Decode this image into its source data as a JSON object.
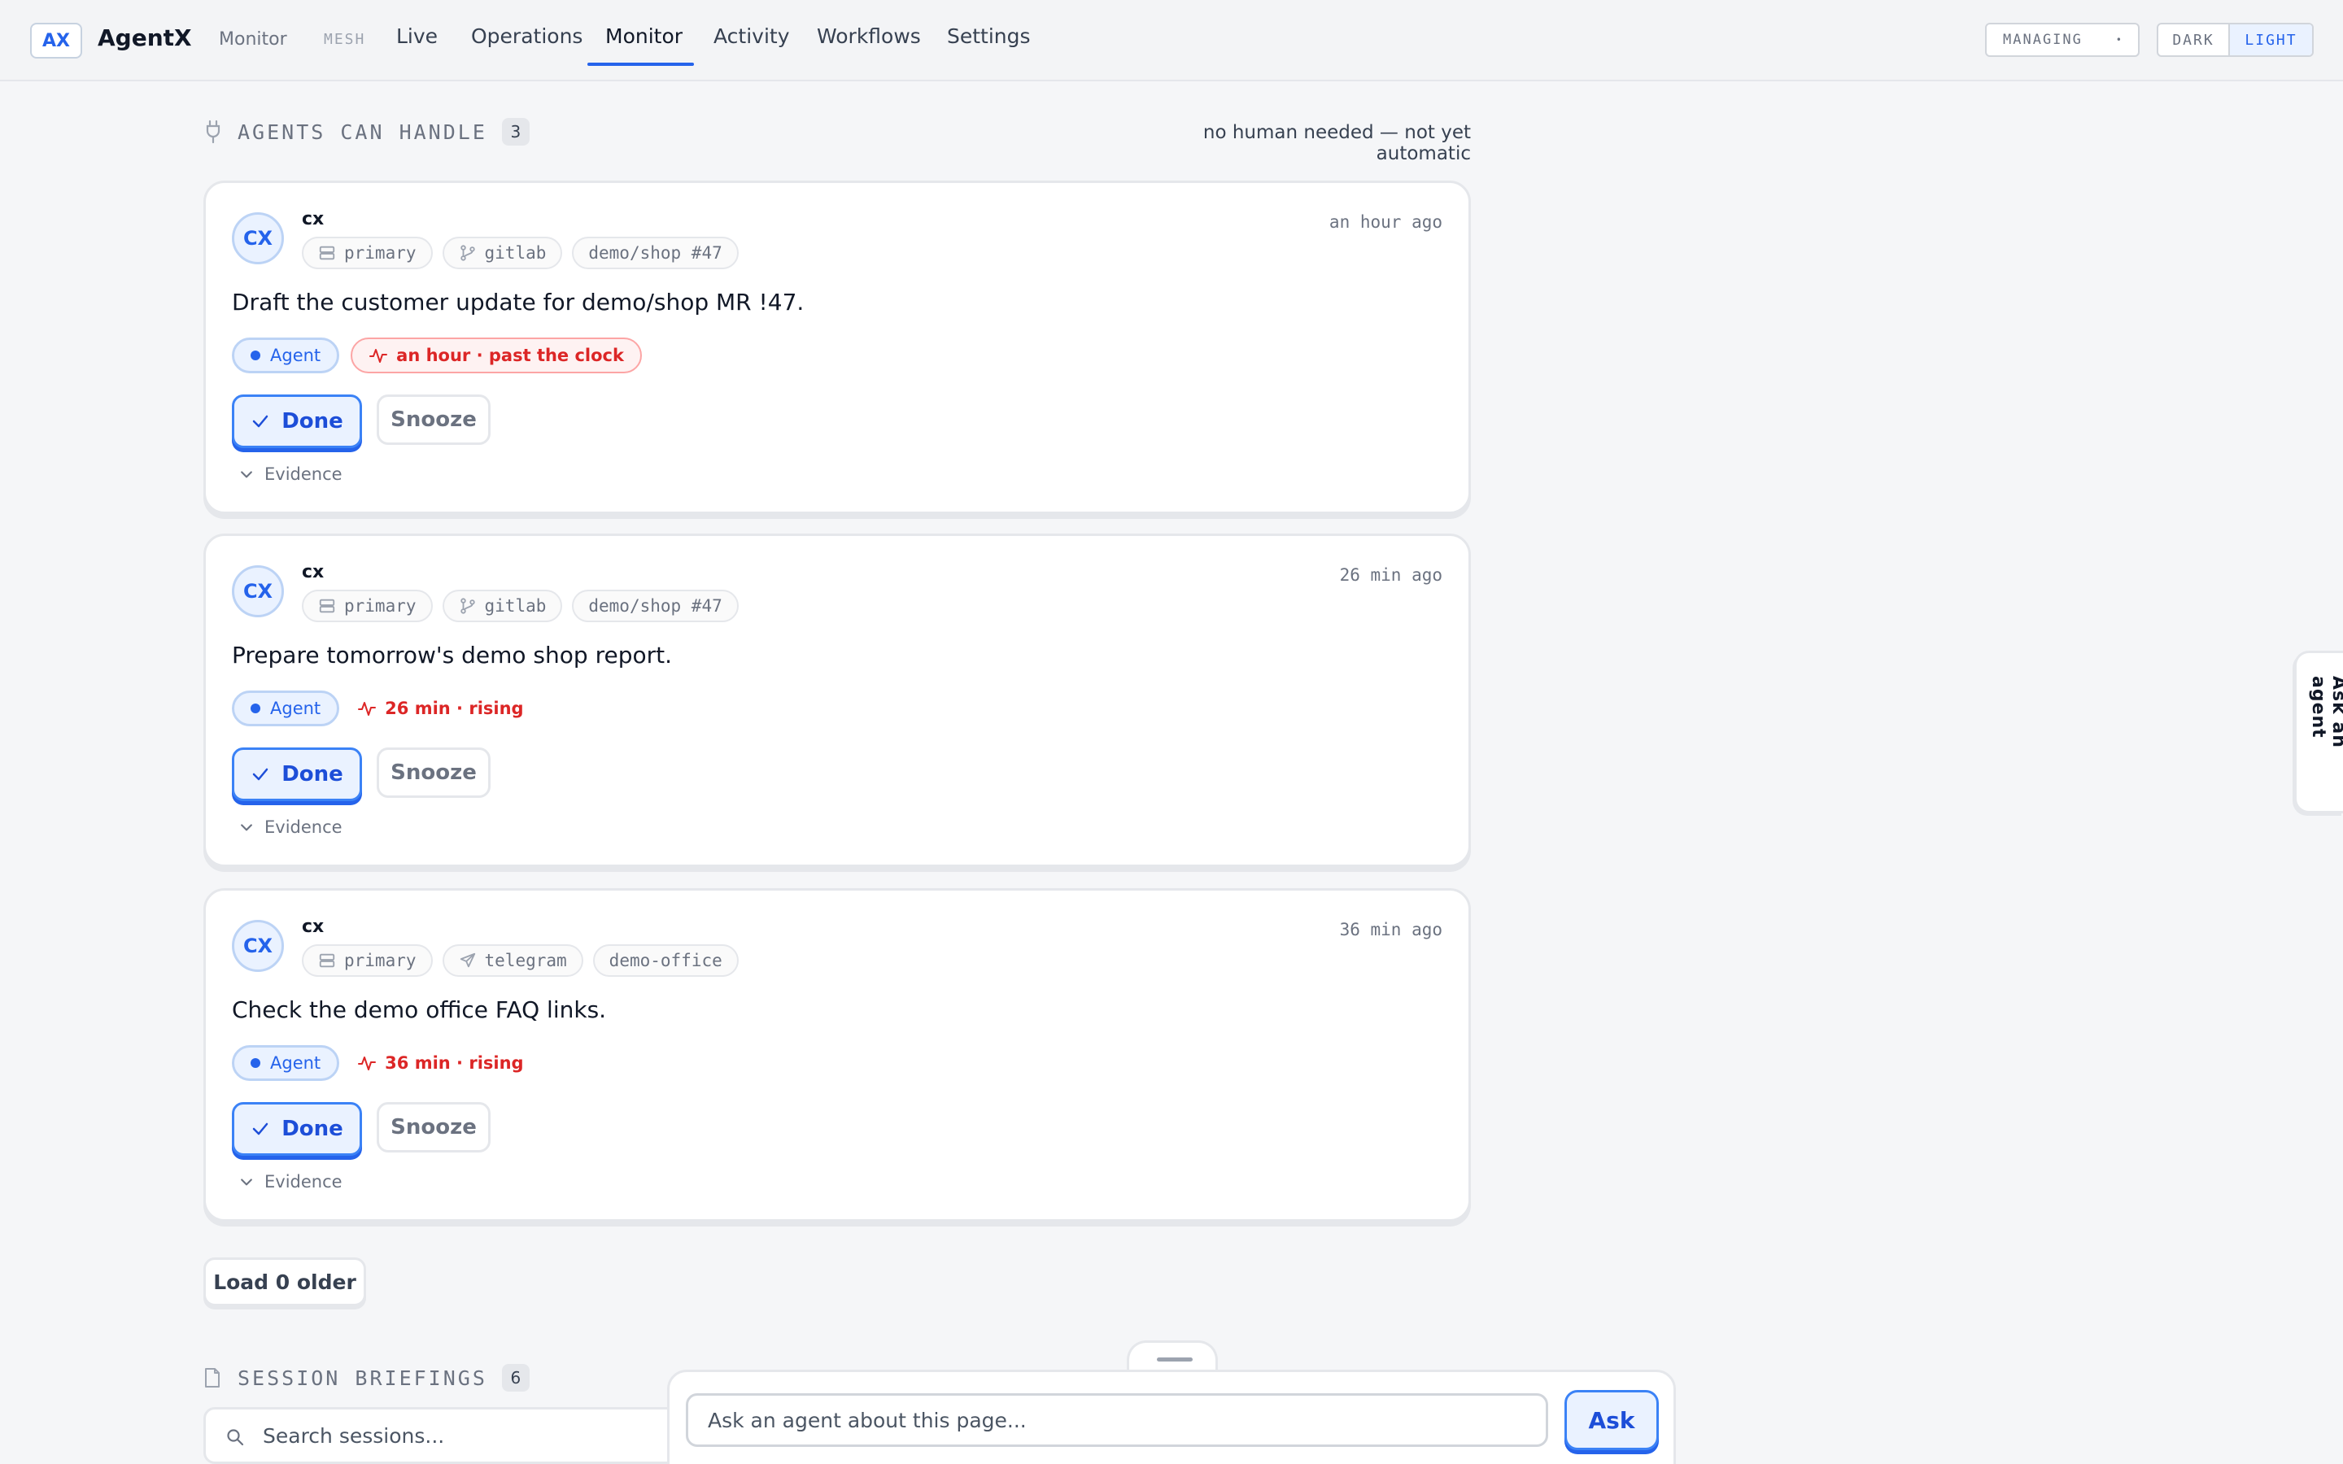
{
  "header": {
    "logo": "AX",
    "brand": "AgentX",
    "crumb": "Monitor",
    "mesh": "MESH",
    "tabs": [
      {
        "label": "Live"
      },
      {
        "label": "Operations"
      },
      {
        "label": "Monitor",
        "active": true
      },
      {
        "label": "Activity"
      },
      {
        "label": "Workflows"
      },
      {
        "label": "Settings"
      }
    ],
    "managing": "MANAGING",
    "theme_dark": "DARK",
    "theme_light": "LIGHT"
  },
  "section": {
    "title": "AGENTS CAN HANDLE",
    "count": "3",
    "note": "no human needed — not yet automatic"
  },
  "cards": [
    {
      "avatar": "CX",
      "author": "cx",
      "chips": [
        "primary",
        "gitlab",
        "demo/shop #47"
      ],
      "timestamp": "an hour ago",
      "task": "Draft the customer update for demo/shop MR !47.",
      "agent_tag": "Agent",
      "clock_tag": "an hour · past the clock",
      "done": "Done",
      "snooze": "Snooze",
      "evidence": "Evidence"
    },
    {
      "avatar": "CX",
      "author": "cx",
      "chips": [
        "primary",
        "gitlab",
        "demo/shop #47"
      ],
      "timestamp": "26 min ago",
      "task": "Prepare tomorrow's demo shop report.",
      "agent_tag": "Agent",
      "clock_tag": "26 min · rising",
      "done": "Done",
      "snooze": "Snooze",
      "evidence": "Evidence"
    },
    {
      "avatar": "CX",
      "author": "cx",
      "chips": [
        "primary",
        "telegram",
        "demo-office"
      ],
      "timestamp": "36 min ago",
      "task": "Check the demo office FAQ links.",
      "agent_tag": "Agent",
      "clock_tag": "36 min · rising",
      "done": "Done",
      "snooze": "Snooze",
      "evidence": "Evidence"
    }
  ],
  "load_older": "Load 0 older",
  "sessions": {
    "title": "SESSION BRIEFINGS",
    "count": "6",
    "search_placeholder": "Search sessions..."
  },
  "ask": {
    "placeholder": "Ask an agent about this page...",
    "button": "Ask",
    "side_tab": "Ask an agent"
  },
  "colors": {
    "accent": "#2563eb",
    "warning": "#dc2626",
    "background": "#f5f6f8"
  }
}
